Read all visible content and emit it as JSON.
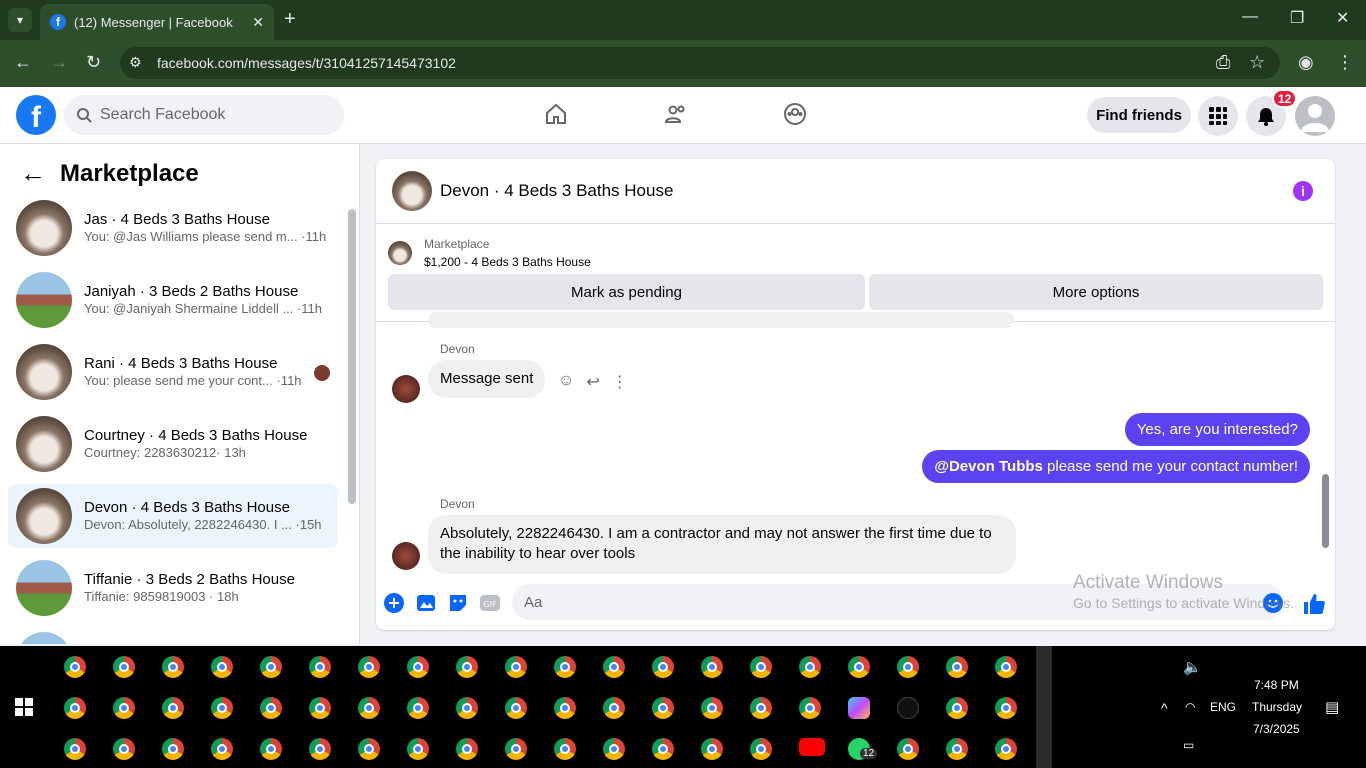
{
  "browser": {
    "tab_title": "(12) Messenger | Facebook",
    "url": "facebook.com/messages/t/31041257145473102"
  },
  "facebook": {
    "search_placeholder": "Search Facebook",
    "find_friends": "Find friends",
    "notification_count": "12"
  },
  "sidebar": {
    "title": "Marketplace",
    "conversations": [
      {
        "name": "Jas · 4 Beds 3 Baths House",
        "preview": "You: @Jas Williams please send m... ·11h"
      },
      {
        "name": "Janiyah · 3 Beds 2 Baths House",
        "preview": "You: @Janiyah Shermaine Liddell ... ·11h"
      },
      {
        "name": "Rani · 4 Beds 3 Baths House",
        "preview": "You: please send me your cont... ·11h"
      },
      {
        "name": "Courtney · 4 Beds 3 Baths House",
        "preview": "Courtney: 2283630212· 13h"
      },
      {
        "name": "Devon · 4 Beds 3 Baths House",
        "preview": "Devon: Absolutely, 2282246430. I ... ·15h"
      },
      {
        "name": "Tiffanie · 3 Beds 2 Baths House",
        "preview": "Tiffanie: 9859819003 · 18h"
      }
    ]
  },
  "chat": {
    "title": "Devon · 4 Beds 3 Baths House",
    "marketplace_label": "Marketplace",
    "listing": "$1,200 - 4 Beds 3 Baths House",
    "mark_pending": "Mark as pending",
    "more_options": "More options",
    "sender1": "Devon",
    "msg1": "Message sent",
    "out1": "Yes, are you interested?",
    "out2_mention": "@Devon Tubbs",
    "out2_rest": " please send me your contact number!",
    "sender2": "Devon",
    "msg2": "Absolutely, 2282246430. I am a contractor and may not answer the first time due to the inability to hear over tools",
    "composer_placeholder": "Aa"
  },
  "watermark": {
    "line1": "Activate Windows",
    "line2": "Go to Settings to activate Windows."
  },
  "taskbar": {
    "language": "ENG",
    "time": "7:48 PM",
    "day": "Thursday",
    "date": "7/3/2025",
    "whatsapp_badge": "12"
  },
  "colors": {
    "facebook_blue": "#1877f2",
    "message_out": "#5b42f3",
    "chrome_frame": "#1f3a1c"
  }
}
